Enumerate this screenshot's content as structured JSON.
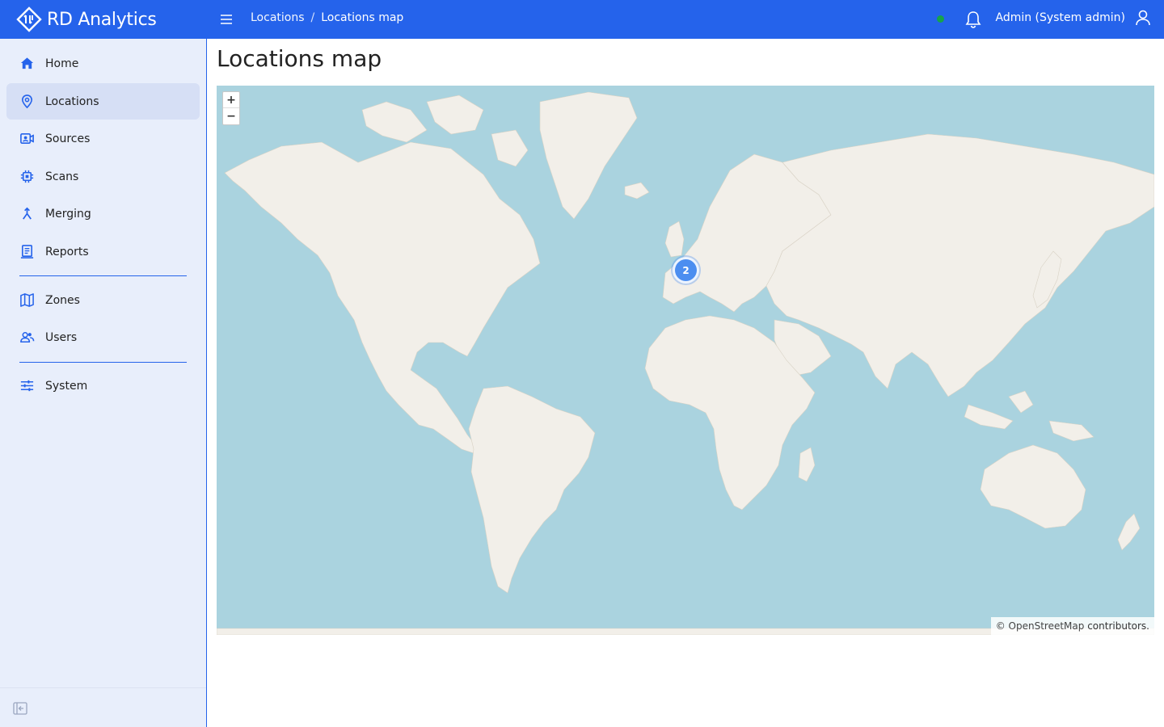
{
  "app": {
    "name": "RD Analytics"
  },
  "breadcrumb": {
    "parent": "Locations",
    "separator": "/",
    "current": "Locations map"
  },
  "header": {
    "status_color": "#16a34a",
    "user_label": "Admin (System admin)"
  },
  "sidebar": {
    "items": [
      {
        "label": "Home",
        "icon": "home-icon"
      },
      {
        "label": "Locations",
        "icon": "map-pin-icon",
        "active": true
      },
      {
        "label": "Sources",
        "icon": "camera-source-icon"
      },
      {
        "label": "Scans",
        "icon": "chip-icon"
      },
      {
        "label": "Merging",
        "icon": "merge-arrow-icon"
      },
      {
        "label": "Reports",
        "icon": "report-icon"
      },
      {
        "label": "Zones",
        "icon": "map-fold-icon"
      },
      {
        "label": "Users",
        "icon": "users-icon"
      },
      {
        "label": "System",
        "icon": "sliders-icon"
      }
    ]
  },
  "page": {
    "title": "Locations map"
  },
  "map": {
    "zoom_in": "+",
    "zoom_out": "−",
    "cluster_count": "2",
    "attribution_prefix": "©",
    "attribution_link": "OpenStreetMap",
    "attribution_suffix": "contributors."
  },
  "colors": {
    "brand": "#2563eb",
    "sidebar_bg": "#e8eefb",
    "water": "#aad3df",
    "land": "#f2efe9",
    "cluster": "#4c8ef0"
  }
}
